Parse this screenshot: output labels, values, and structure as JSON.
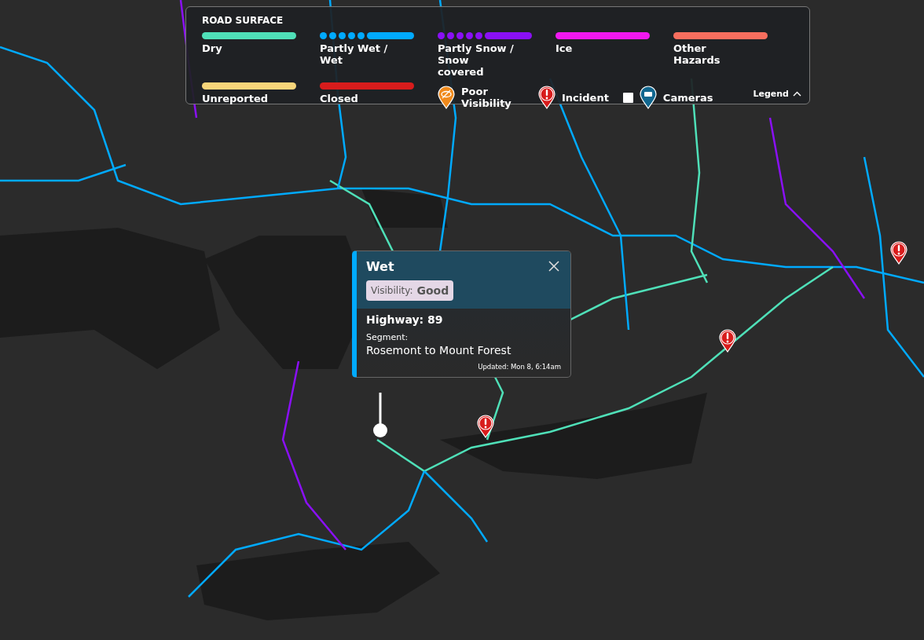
{
  "legend": {
    "title": "ROAD SURFACE",
    "items": [
      {
        "kind": "solid",
        "label": "Dry",
        "color": "#4fe0b8"
      },
      {
        "kind": "dotted",
        "label": "Partly Wet / Wet",
        "color": "#00aaff"
      },
      {
        "kind": "dotted",
        "label": "Partly Snow / Snow covered",
        "color": "#8a10f5"
      },
      {
        "kind": "solid",
        "label": "Ice",
        "color": "#f018f0"
      },
      {
        "kind": "solid",
        "label": "Other Hazards",
        "color": "#f76e5e"
      },
      {
        "kind": "solid",
        "label": "Unreported",
        "color": "#f8d57a"
      },
      {
        "kind": "solid",
        "label": "Closed",
        "color": "#d81c1c"
      },
      {
        "kind": "visibility",
        "label": "Poor Visibility",
        "color": "#f08a1c"
      },
      {
        "kind": "incident",
        "label": "Incident",
        "color": "#d81c1c"
      }
    ],
    "cameras": {
      "label": "Cameras",
      "checked": false,
      "color": "#11678f"
    },
    "toggle": "Legend"
  },
  "popup": {
    "condition": "Wet",
    "color": "#00aaff",
    "visibility_label": "Visibility:",
    "visibility_value": "Good",
    "highway": "Highway: 89",
    "segment_label": "Segment:",
    "segment": "Rosemont to Mount Forest",
    "updated": "Updated: Mon 8, 6:14am"
  }
}
